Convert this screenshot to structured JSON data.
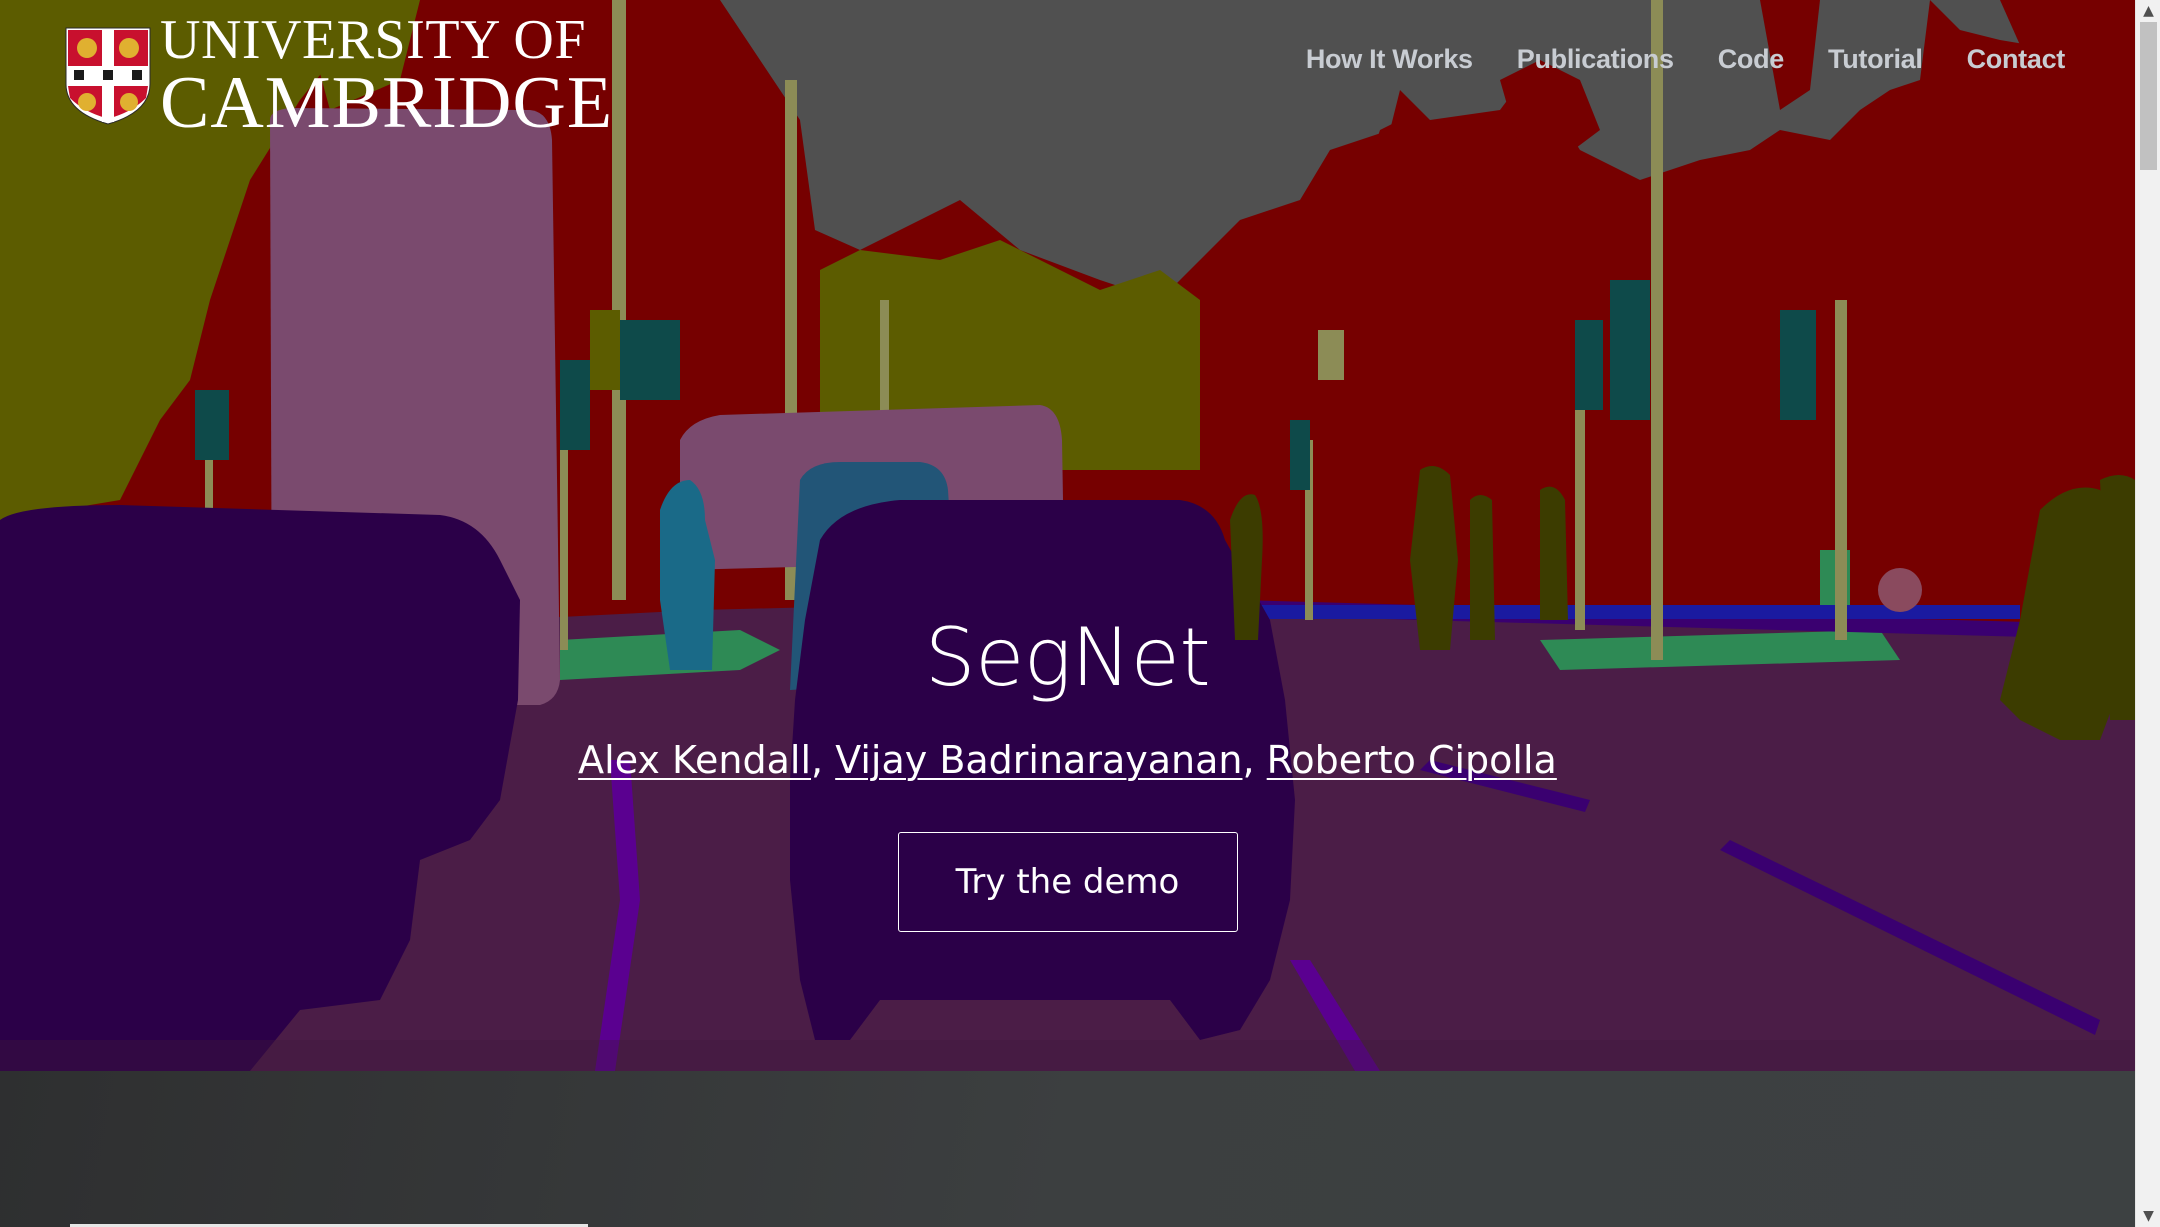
{
  "header": {
    "logo": {
      "line1": "UNIVERSITY OF",
      "line2": "CAMBRIDGE"
    },
    "nav": [
      {
        "label": "How It Works"
      },
      {
        "label": "Publications"
      },
      {
        "label": "Code"
      },
      {
        "label": "Tutorial"
      },
      {
        "label": "Contact"
      }
    ]
  },
  "hero": {
    "title": "SegNet",
    "authors": [
      {
        "name": "Alex Kendall"
      },
      {
        "name": "Vijay Badrinarayanan"
      },
      {
        "name": "Roberto Cipolla"
      }
    ],
    "separator": ",",
    "cta": "Try the demo"
  },
  "colors": {
    "building": "#760000",
    "sky": "#505050",
    "tree": "#5c5c00",
    "vehicle": "#2b0048",
    "road": "#4b1d47",
    "pole": "#8c8c56",
    "truck": "#7a4a6e",
    "pedestrian": "#3c3c00",
    "pavement": "#2e8a55",
    "sign": "#0e4a4a",
    "lane": "#5a0090"
  },
  "scrollbar": {
    "up_icon": "triangle-up",
    "down_icon": "triangle-down"
  }
}
